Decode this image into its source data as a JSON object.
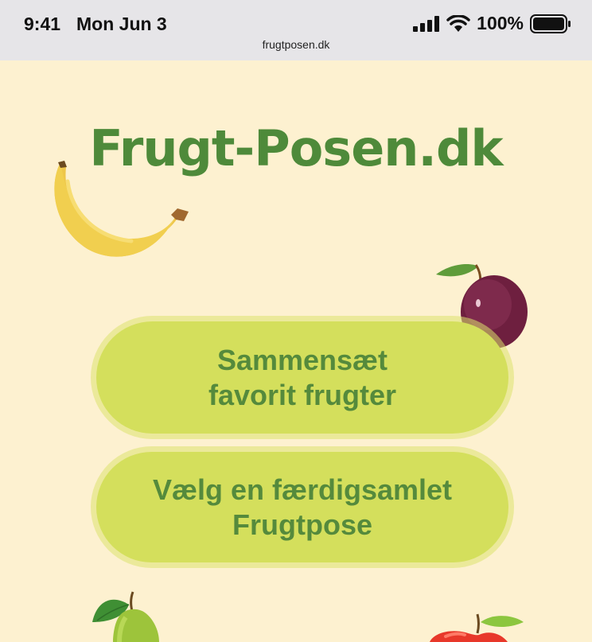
{
  "status_bar": {
    "time": "9:41",
    "date": "Mon Jun 3",
    "url": "frugtposen.dk",
    "battery": "100%"
  },
  "header": {
    "title": "Frugt-Posen.dk"
  },
  "buttons": {
    "compose_label": "Sammensæt\nfavorit frugter",
    "choose_label": "Vælg en færdigsamlet\nFrugtpose"
  },
  "colors": {
    "background": "#fdf1d0",
    "title": "#4e8a3a",
    "button": "#d4df5c",
    "button_text": "#558a3c"
  },
  "icons": [
    "banana-icon",
    "plum-icon",
    "pear-icon",
    "apple-icon",
    "signal-icon",
    "wifi-icon",
    "battery-icon"
  ]
}
